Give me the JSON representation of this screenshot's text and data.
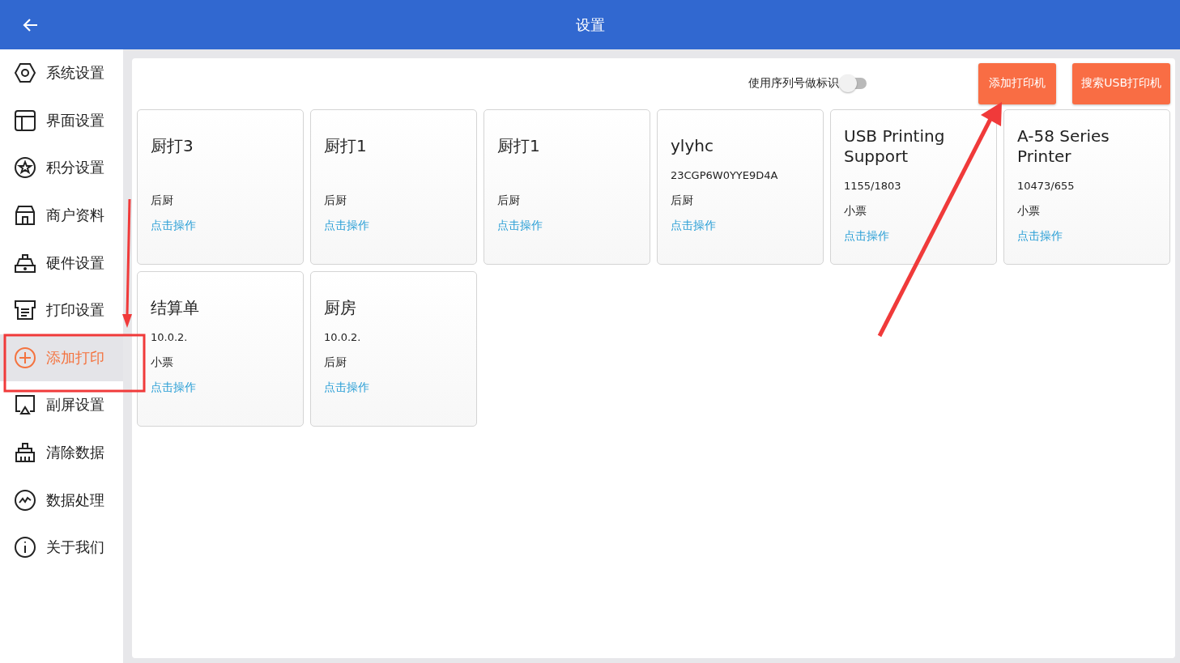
{
  "header": {
    "title": "设置"
  },
  "sidebar": {
    "items": [
      {
        "label": "系统设置",
        "selected": false
      },
      {
        "label": "界面设置",
        "selected": false
      },
      {
        "label": "积分设置",
        "selected": false
      },
      {
        "label": "商户资料",
        "selected": false
      },
      {
        "label": "硬件设置",
        "selected": false
      },
      {
        "label": "打印设置",
        "selected": false
      },
      {
        "label": "添加打印",
        "selected": true
      },
      {
        "label": "副屏设置",
        "selected": false
      },
      {
        "label": "清除数据",
        "selected": false
      },
      {
        "label": "数据处理",
        "selected": false
      },
      {
        "label": "关于我们",
        "selected": false
      }
    ]
  },
  "toolbar": {
    "toggle": {
      "label": "使用序列号做标识",
      "on": false
    },
    "buttons": [
      "添加打印机",
      "搜索USB打印机"
    ]
  },
  "printers": [
    {
      "name": "厨打3",
      "type": "后厨",
      "action": "点击操作"
    },
    {
      "name": "厨打1",
      "type": "后厨",
      "action": "点击操作"
    },
    {
      "name": "厨打1",
      "type": "后厨",
      "action": "点击操作"
    },
    {
      "name": "ylyhc",
      "detail": "23CGP6W0YYE9D4A",
      "type": "后厨",
      "action": "点击操作"
    },
    {
      "name": "USB Printing Support",
      "detail": "1155/1803",
      "type": "小票",
      "action": "点击操作"
    },
    {
      "name": "A-58 Series Printer",
      "detail": "10473/655",
      "type": "小票",
      "action": "点击操作"
    },
    {
      "name": "结算单",
      "detail": "10.0.2.",
      "type": "小票",
      "action": "点击操作"
    },
    {
      "name": "厨房",
      "detail": "10.0.2.",
      "type": "后厨",
      "action": "点击操作"
    }
  ]
}
